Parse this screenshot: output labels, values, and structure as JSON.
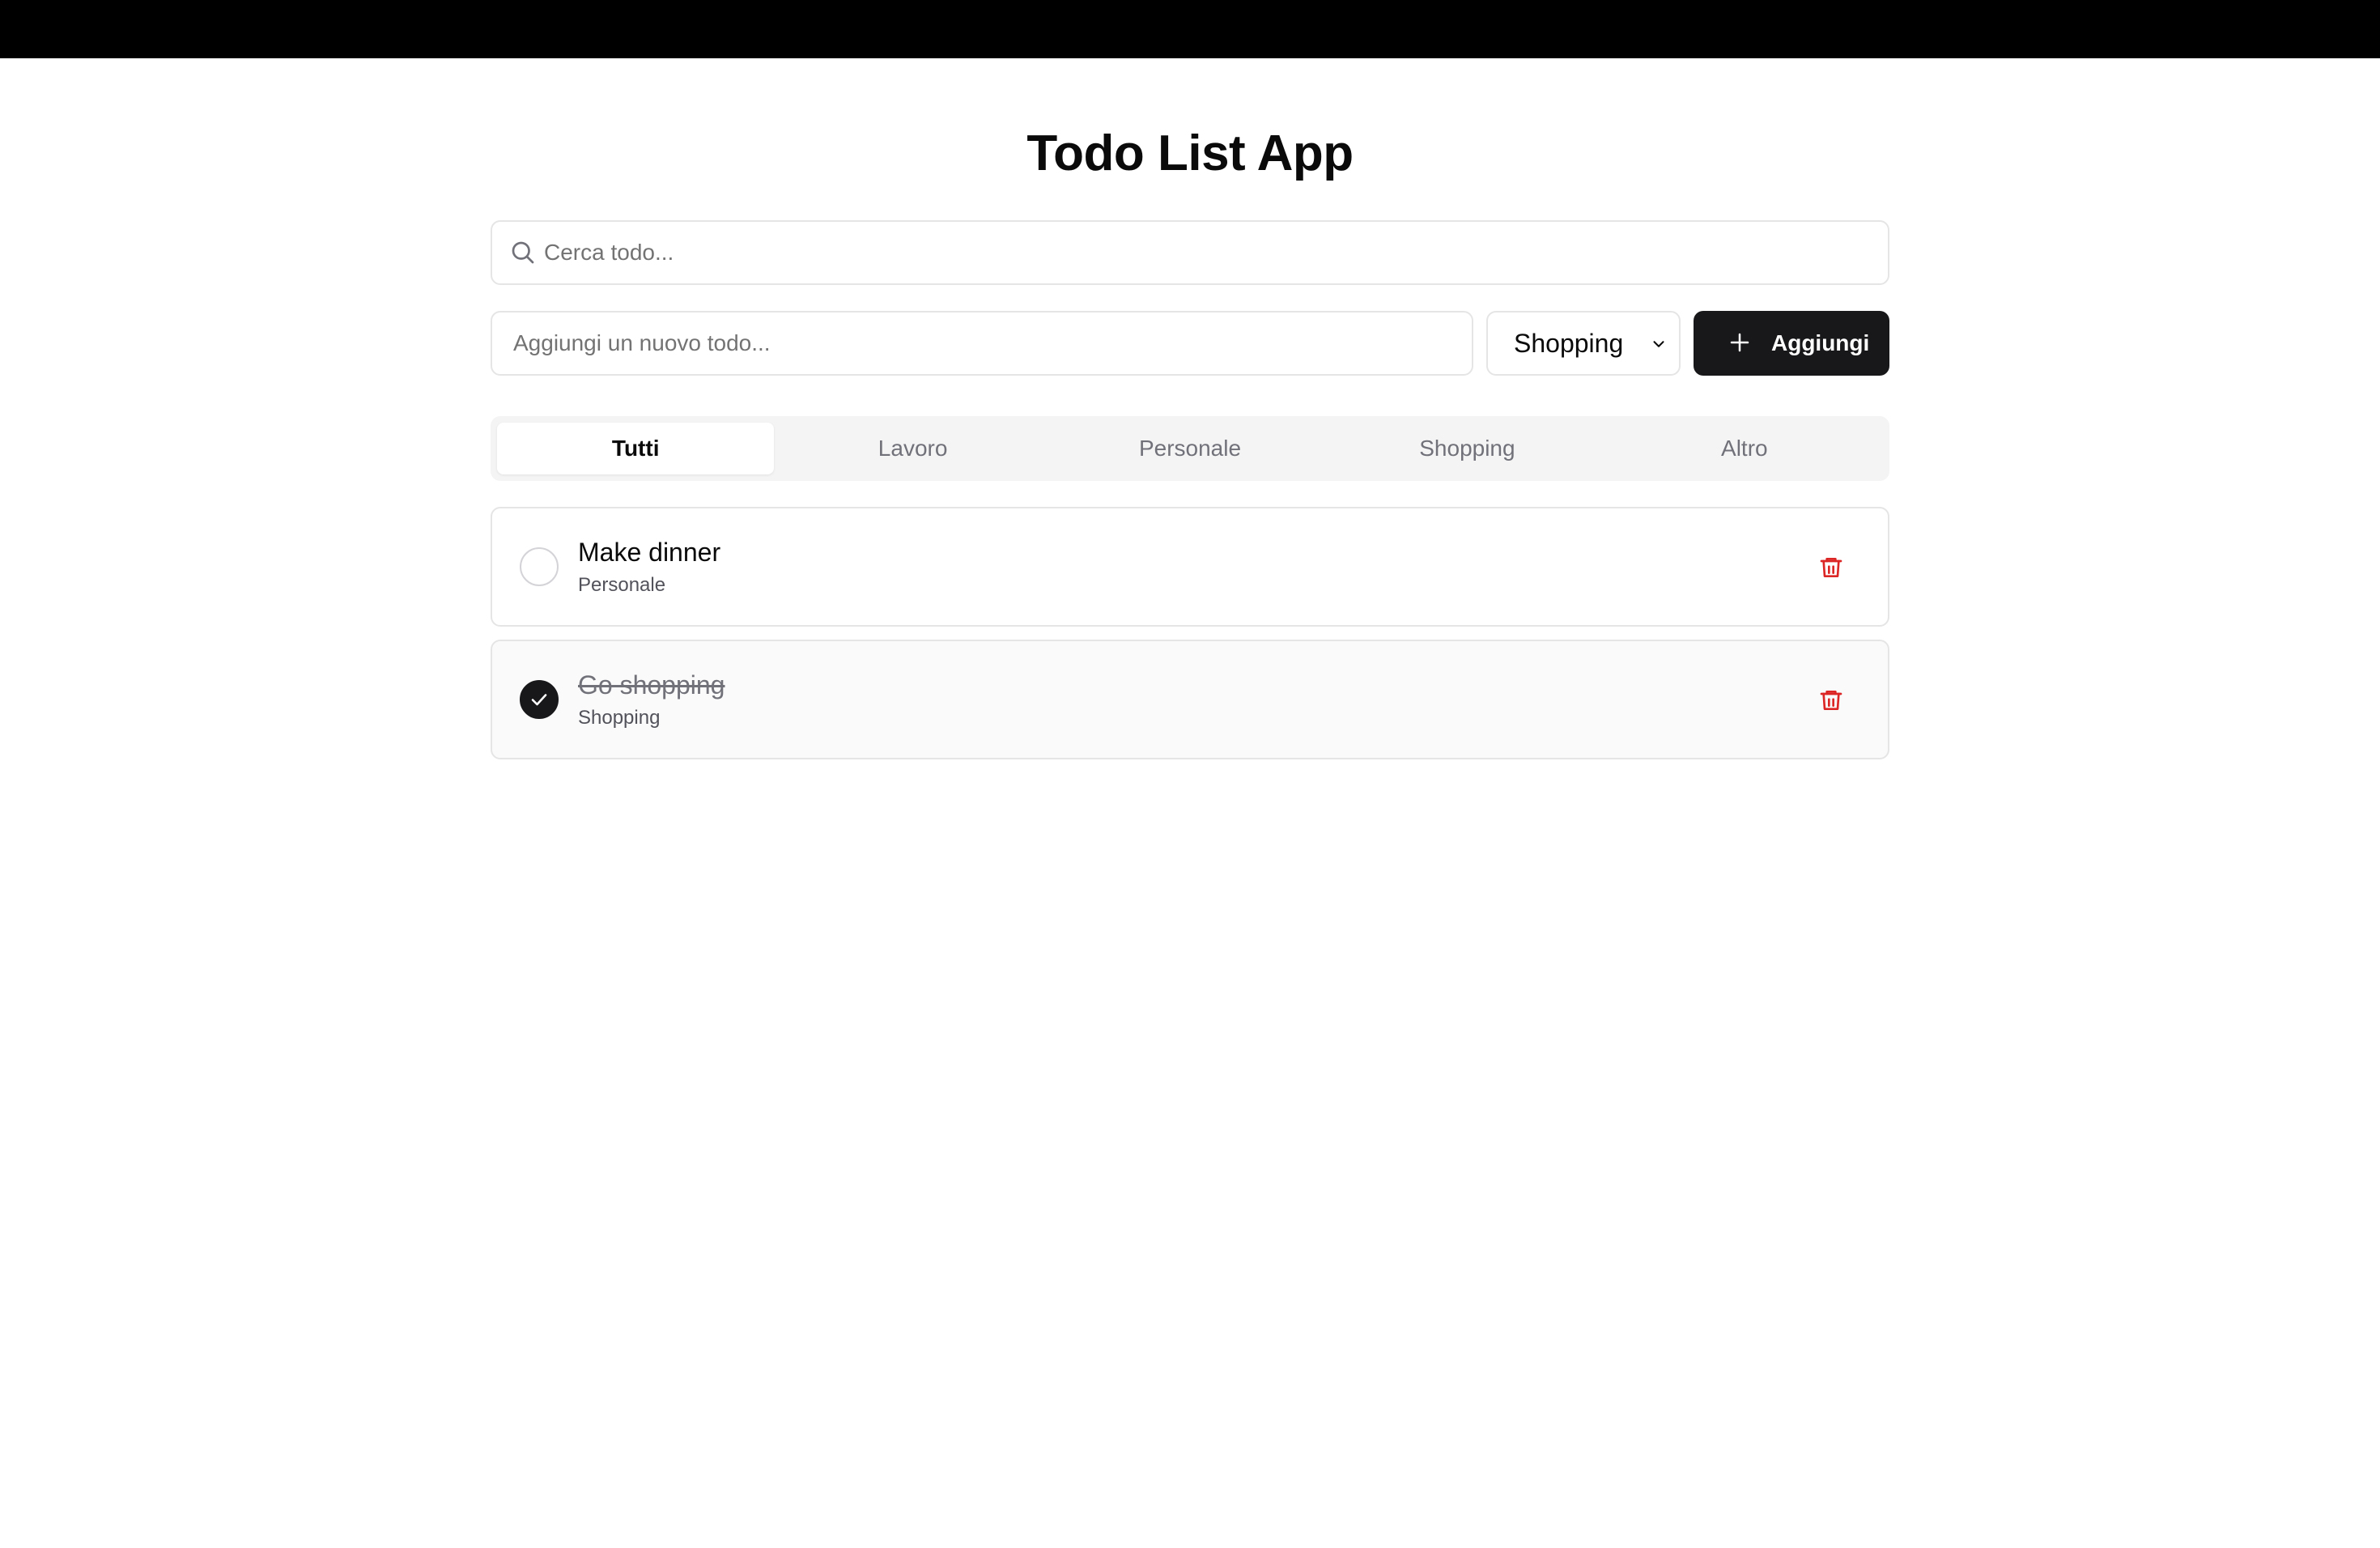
{
  "app": {
    "title": "Todo List App"
  },
  "search": {
    "placeholder": "Cerca todo...",
    "value": "",
    "icon": "search-icon"
  },
  "add": {
    "input_placeholder": "Aggiungi un nuovo todo...",
    "input_value": "",
    "category_selected": "Shopping",
    "button_label": "Aggiungi",
    "button_icon": "plus-icon"
  },
  "tabs": [
    {
      "label": "Tutti",
      "active": true
    },
    {
      "label": "Lavoro",
      "active": false
    },
    {
      "label": "Personale",
      "active": false
    },
    {
      "label": "Shopping",
      "active": false
    },
    {
      "label": "Altro",
      "active": false
    }
  ],
  "todos": [
    {
      "text": "Make dinner",
      "category": "Personale",
      "done": false
    },
    {
      "text": "Go shopping",
      "category": "Shopping",
      "done": true
    }
  ],
  "colors": {
    "primary": "#18181b",
    "delete": "#dc2626",
    "border": "#e5e5e5",
    "muted": "#71717a"
  }
}
